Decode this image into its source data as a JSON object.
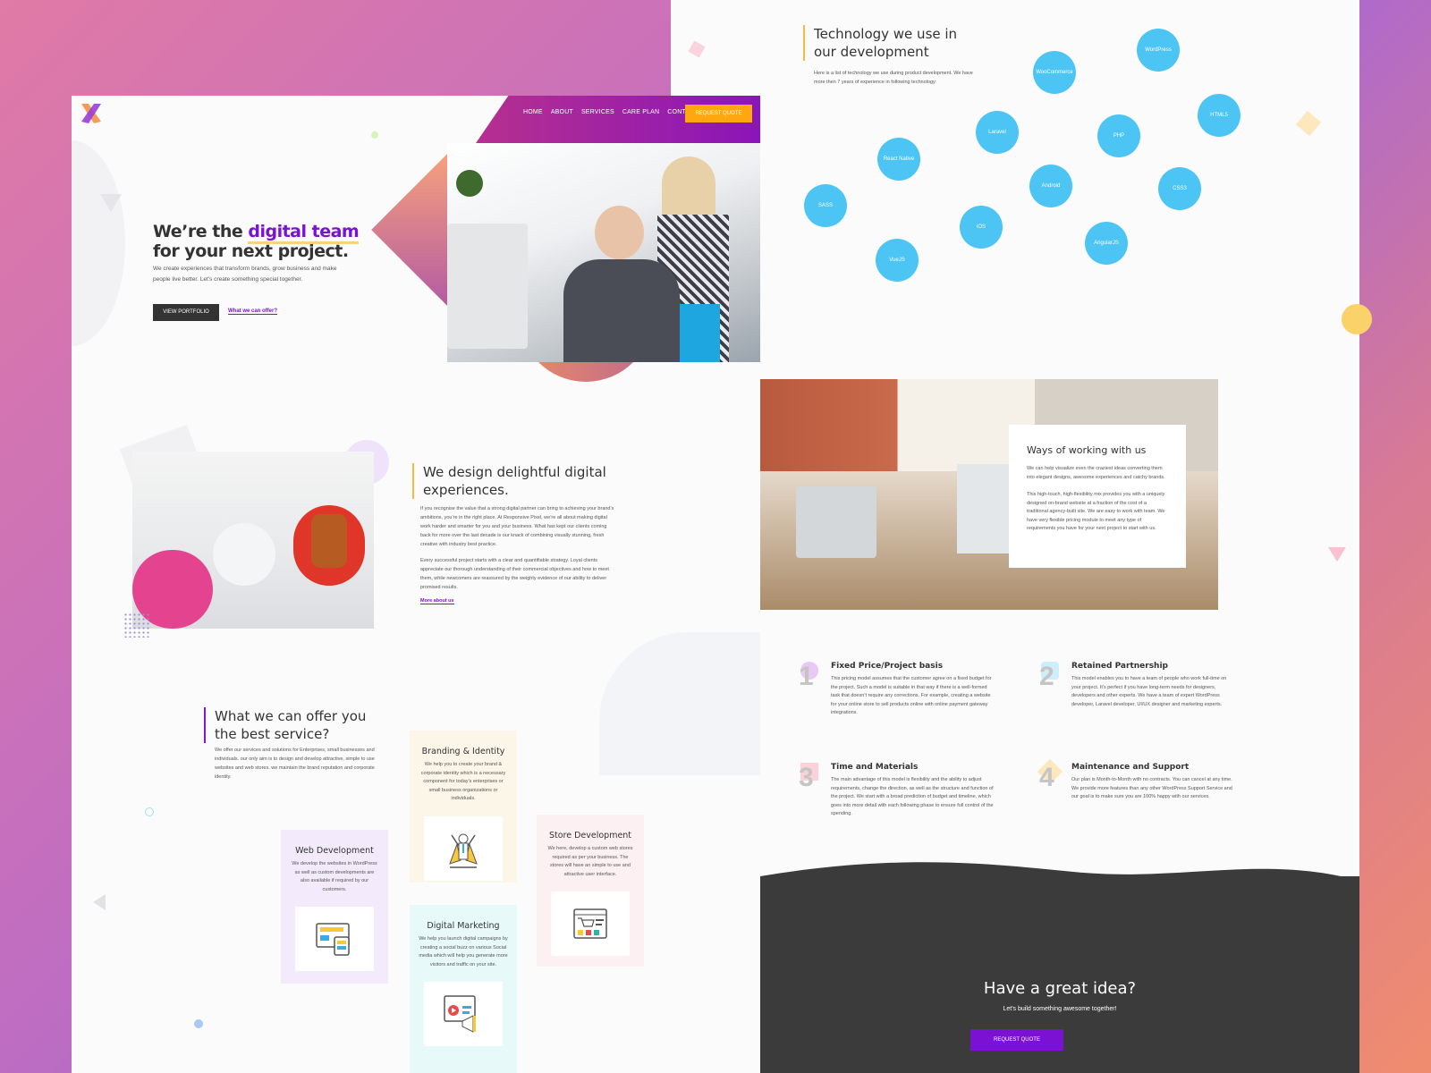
{
  "colors": {
    "brand_purple": "#7b11d3",
    "accent_orange": "#ffa610",
    "bubble_blue": "#4cc4f4",
    "footer_dark": "#3b3b3b"
  },
  "nav": {
    "items": [
      "HOME",
      "ABOUT",
      "SERVICES",
      "CARE PLAN",
      "CONTACT"
    ],
    "cta": "REQUEST QUOTE"
  },
  "hero": {
    "title_pre": "We’re the ",
    "title_highlight": "digital team",
    "title_post": "for your next project.",
    "text": "We create experiences that transform brands, grow business and make people live better. Let’s create something special together.",
    "btn_primary": "VIEW PORTFOLIO",
    "btn_link": "What we can offer?"
  },
  "about": {
    "title": "We design delightful digital experiences.",
    "p1": "If you recognise the value that a strong digital partner can bring to achieving your brand’s ambitions, you’re in the right place. At Responsive Pixel, we’re all about making digital work harder and smarter for you and your business. What has kept our clients coming back for more over the last decade is our knack of combining visually stunning, fresh creative with industry best practice.",
    "p2": "Every successful project starts with a clear and quantifiable strategy. Loyal clients appreciate our thorough understanding of their commercial objectives and how to meet them, while newcomers are reassured by the weighty evidence of our ability to deliver promised results.",
    "link": "More about us"
  },
  "services": {
    "title": "What we can offer you the best service?",
    "text": "We offer our services and solutions for Enterprises, small businesses and individuals. our only aim is to design and develop attractive, simple to use websites and web stores. we maintain the brand reputation and corporate identity.",
    "cards": [
      {
        "title": "Web Development",
        "text": "We develop the websites in WordPress as well as custom developments are also available if required by our customers.",
        "icon": "web-layout-icon",
        "bg": "#f3ebfb"
      },
      {
        "title": "Branding & Identity",
        "text": "We help you to create your brand & corporate identity which is a necessary component for today’s enterprises or small business organizations or individuals.",
        "icon": "superhero-icon",
        "bg": "#fbf6e8"
      },
      {
        "title": "Digital Marketing",
        "text": "We help you launch digital campaigns by creating a social buzz on various Social media which will help you generate more visitors and traffic on your site.",
        "icon": "megaphone-icon",
        "bg": "#e8f9f9"
      },
      {
        "title": "Store Development",
        "text": "We here, develop a custom web stores required as per your business. The stores will have an simple to use and attractive user interface.",
        "icon": "shopping-cart-icon",
        "bg": "#fdf0f3"
      }
    ]
  },
  "tech": {
    "title": "Technology we use in our development",
    "text": "Here is a list of technology we use during product development. We have more then 7 years of experience in following technology:",
    "items": [
      "WordPress",
      "WooCommerce",
      "HTML5",
      "Laravel",
      "PHP",
      "React Native",
      "Android",
      "CSS3",
      "SASS",
      "iOS",
      "AngularJS",
      "VueJS"
    ]
  },
  "ways": {
    "title": "Ways of working with us",
    "p1": "We can help visualize even the craziest ideas converting them into elegant designs, awesome experiences and catchy brands.",
    "p2": "This high-touch, high-flexibility mix provides you with a uniquely designed on-brand website at a fraction of the cost of a traditional agency-built site. We are easy to work with team. We have very flexible pricing module to meet any type of requirements you have for your next project to start with us."
  },
  "plans": [
    {
      "num": "1",
      "title": "Fixed Price/Project basis",
      "text": "This pricing model assumes that the customer agree on a fixed budget for the project. Such a model is suitable in that way if there is a well-formed task that doesn’t require any corrections. For example, creating a website for your online store to sell products online with online payment gateway integrations.",
      "shape_color": "#e9c8f5"
    },
    {
      "num": "2",
      "title": "Retained Partnership",
      "text": "This model enables you to have a team of people who work full-time on your project. It’s perfect if you have long-term needs for designers, developers and other experts. We have a team of expert WordPress developer, Laravel developer, UI/UX designer and marketing experts.",
      "shape_color": "#cfeefc"
    },
    {
      "num": "3",
      "title": "Time and Materials",
      "text": "The main advantage of this model is flexibility and the ability to adjust requirements, change the direction, as well as the structure and function of the project. We start with a broad prediction of budget and timeline, which goes into more detail with each following phase to ensure full control of the spending.",
      "shape_color": "#fbd3d6"
    },
    {
      "num": "4",
      "title": "Maintenance and Support",
      "text": "Our plan is Month-to-Month with no contracts. You can cancel at any time. We provide more features than any other WordPress Support Service and our goal is to make sure you are 100% happy with our services.",
      "shape_color": "#fde7bd"
    }
  ],
  "footer": {
    "title": "Have a great idea?",
    "subtitle": "Let's build something awesome together!",
    "cta": "REQUEST QUOTE"
  }
}
